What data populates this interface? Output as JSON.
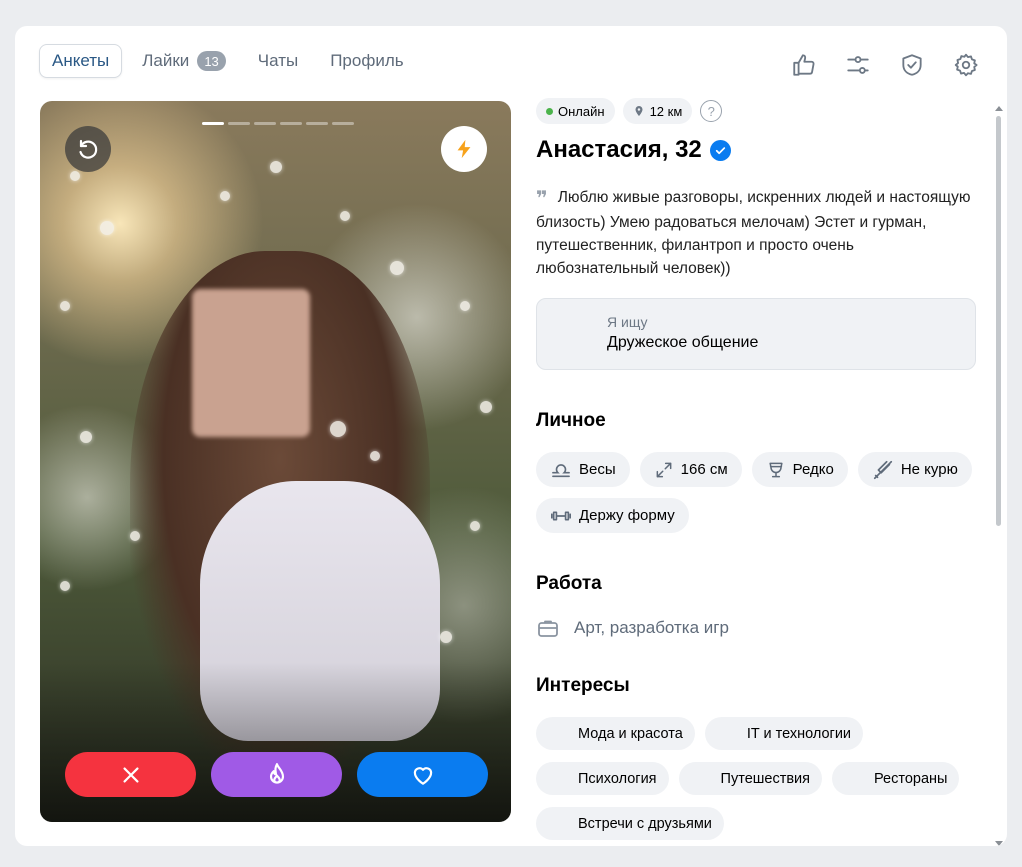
{
  "nav": {
    "tabs": [
      {
        "label": "Анкеты"
      },
      {
        "label": "Лайки",
        "badge": "13"
      },
      {
        "label": "Чаты"
      },
      {
        "label": "Профиль"
      }
    ],
    "icons": [
      "thumbs-up-icon",
      "filters-icon",
      "shield-icon",
      "gear-icon"
    ]
  },
  "photo": {
    "photo_count": 6,
    "active_index": 0
  },
  "profile": {
    "status": "Онлайн",
    "distance": "12 км",
    "help": "?",
    "name": "Анастасия, 32",
    "bio": "Люблю живые разговоры, искренних людей и настоящую близость) Умею радоваться мелочам) Эстет и гурман, путешественник, филантроп и просто очень любознательный человек))",
    "seeking": {
      "label": "Я ищу",
      "value": "Дружеское общение"
    }
  },
  "personal": {
    "title": "Личное",
    "items": [
      {
        "icon": "libra-icon",
        "label": "Весы"
      },
      {
        "icon": "height-icon",
        "label": "166 см"
      },
      {
        "icon": "glass-icon",
        "label": "Редко"
      },
      {
        "icon": "no-smoking-icon",
        "label": "Не курю"
      },
      {
        "icon": "dumbbell-icon",
        "label": "Держу форму"
      }
    ]
  },
  "work": {
    "title": "Работа",
    "value": "Арт, разработка игр"
  },
  "interests": {
    "title": "Интересы",
    "items": [
      "Мода и красота",
      "IT и технологии",
      "Психология",
      "Путешествия",
      "Рестораны",
      "Встречи с друзьями"
    ]
  },
  "colors": {
    "accent": "#0a7cf0",
    "dislike": "#f5333f",
    "superlike": "#a05ae6",
    "online": "#4bb34b"
  }
}
